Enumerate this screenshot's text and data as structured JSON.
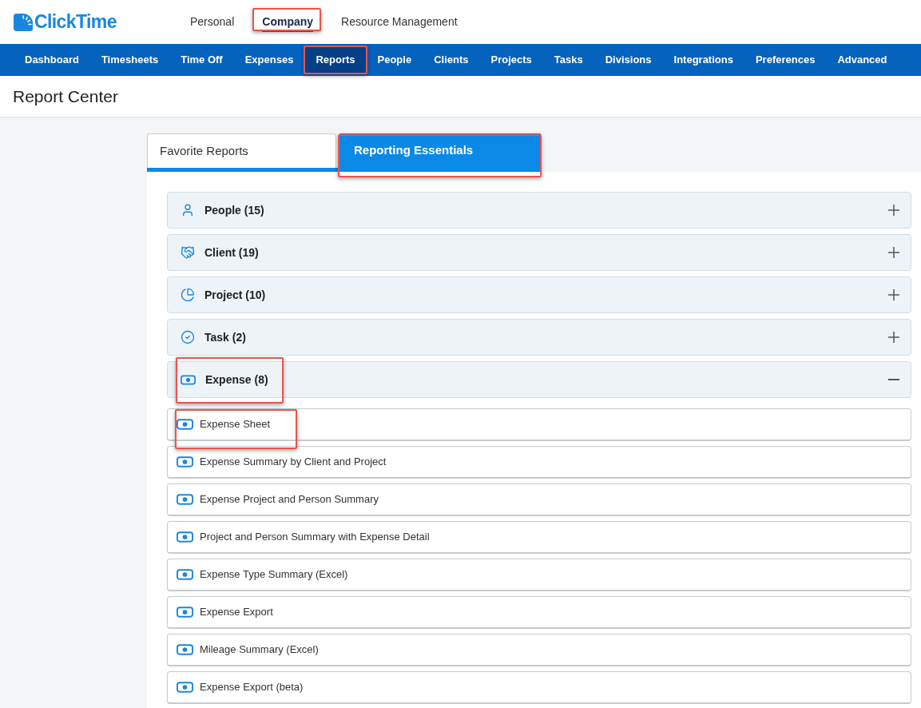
{
  "logo": {
    "text": "ClickTime"
  },
  "top_tabs": [
    {
      "label": "Personal",
      "selected": false,
      "highlighted": false
    },
    {
      "label": "Company",
      "selected": true,
      "highlighted": true
    },
    {
      "label": "Resource Management",
      "selected": false,
      "highlighted": false
    }
  ],
  "nav": [
    {
      "label": "Dashboard",
      "selected": false,
      "highlighted": false
    },
    {
      "label": "Timesheets",
      "selected": false,
      "highlighted": false
    },
    {
      "label": "Time Off",
      "selected": false,
      "highlighted": false
    },
    {
      "label": "Expenses",
      "selected": false,
      "highlighted": false
    },
    {
      "label": "Reports",
      "selected": true,
      "highlighted": true
    },
    {
      "label": "People",
      "selected": false,
      "highlighted": false
    },
    {
      "label": "Clients",
      "selected": false,
      "highlighted": false
    },
    {
      "label": "Projects",
      "selected": false,
      "highlighted": false
    },
    {
      "label": "Tasks",
      "selected": false,
      "highlighted": false
    },
    {
      "label": "Divisions",
      "selected": false,
      "highlighted": false
    },
    {
      "label": "Integrations",
      "selected": false,
      "highlighted": false
    },
    {
      "label": "Preferences",
      "selected": false,
      "highlighted": false
    },
    {
      "label": "Advanced",
      "selected": false,
      "highlighted": false
    }
  ],
  "page_title": "Report Center",
  "tabs": [
    {
      "label": "Favorite Reports",
      "selected": false,
      "highlighted": false
    },
    {
      "label": "Reporting Essentials",
      "selected": true,
      "highlighted": true
    }
  ],
  "groups": [
    {
      "kind": "people",
      "label": "People (15)",
      "expanded": false,
      "highlighted": false
    },
    {
      "kind": "client",
      "label": "Client (19)",
      "expanded": false,
      "highlighted": false
    },
    {
      "kind": "project",
      "label": "Project (10)",
      "expanded": false,
      "highlighted": false
    },
    {
      "kind": "task",
      "label": "Task (2)",
      "expanded": false,
      "highlighted": false
    },
    {
      "kind": "expense",
      "label": "Expense (8)",
      "expanded": true,
      "highlighted": true,
      "reports": [
        {
          "label": "Expense Sheet",
          "highlighted": true
        },
        {
          "label": "Expense Summary by Client and Project",
          "highlighted": false
        },
        {
          "label": "Expense Project and Person Summary",
          "highlighted": false
        },
        {
          "label": "Project and Person Summary with Expense Detail",
          "highlighted": false
        },
        {
          "label": "Expense Type Summary (Excel)",
          "highlighted": false
        },
        {
          "label": "Expense Export",
          "highlighted": false
        },
        {
          "label": "Mileage Summary (Excel)",
          "highlighted": false
        },
        {
          "label": "Expense Export (beta)",
          "highlighted": false
        }
      ]
    }
  ]
}
